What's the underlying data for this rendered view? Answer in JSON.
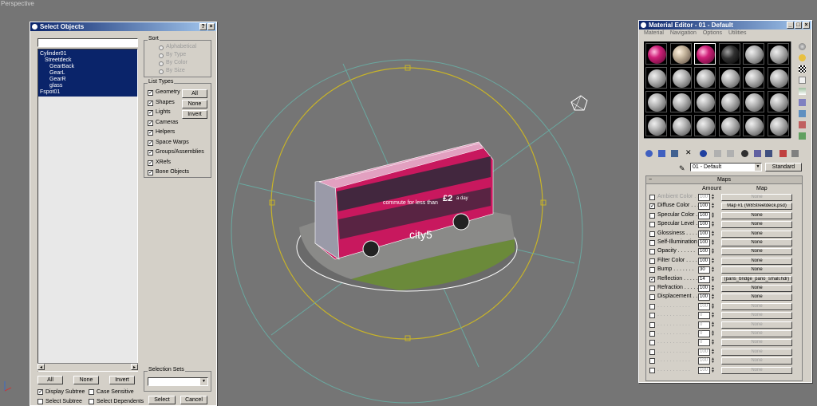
{
  "viewport": {
    "label": "Perspective"
  },
  "select_objects": {
    "title": "Select Objects",
    "help_btn": "?",
    "close_btn": "×",
    "search_value": "",
    "items": [
      {
        "label": "Cylinder01",
        "indent": 0
      },
      {
        "label": "Streetdeck",
        "indent": 1
      },
      {
        "label": "GearBack",
        "indent": 2
      },
      {
        "label": "GearL",
        "indent": 2
      },
      {
        "label": "GearR",
        "indent": 2
      },
      {
        "label": "glass",
        "indent": 2
      },
      {
        "label": "Fspot01",
        "indent": 0
      }
    ],
    "sort": {
      "title": "Sort",
      "options": [
        "Alphabetical",
        "By Type",
        "By Color",
        "By Size"
      ]
    },
    "list_types": {
      "title": "List Types",
      "items": [
        "Geometry",
        "Shapes",
        "Lights",
        "Cameras",
        "Helpers",
        "Space Warps",
        "Groups/Assemblies",
        "XRefs",
        "Bone Objects"
      ],
      "all_label": "All",
      "none_label": "None",
      "invert_label": "Invert"
    },
    "bottom": {
      "all": "All",
      "none": "None",
      "invert": "Invert",
      "display_subtree": "Display Subtree",
      "case_sensitive": "Case Sensitive",
      "select_subtree": "Select Subtree",
      "select_dependents": "Select Dependents"
    },
    "selection_sets": {
      "title": "Selection Sets",
      "value": ""
    },
    "select_btn": "Select",
    "cancel_btn": "Cancel"
  },
  "material_editor": {
    "title": "Material Editor - 01 - Default",
    "menu": [
      "Material",
      "Navigation",
      "Options",
      "Utilities"
    ],
    "material_name": "01 - Default",
    "type_btn": "Standard",
    "maps_title": "Maps",
    "col_amount": "Amount",
    "col_map": "Map",
    "maps": [
      {
        "name": "Ambient Color . . .",
        "checked": false,
        "amount": "100",
        "map": "None",
        "disabled": true
      },
      {
        "name": "Diffuse Color . . . .",
        "checked": true,
        "amount": "100",
        "map": "Map #1 (W8Streetdeck.psd)",
        "disabled": false
      },
      {
        "name": "Specular Color . . .",
        "checked": false,
        "amount": "100",
        "map": "None",
        "disabled": false
      },
      {
        "name": "Specular Level . . .",
        "checked": false,
        "amount": "100",
        "map": "None",
        "disabled": false
      },
      {
        "name": "Glossiness . . . . .",
        "checked": false,
        "amount": "100",
        "map": "None",
        "disabled": false
      },
      {
        "name": "Self-Illumination . .",
        "checked": false,
        "amount": "100",
        "map": "None",
        "disabled": false
      },
      {
        "name": "Opacity . . . . . .",
        "checked": false,
        "amount": "100",
        "map": "None",
        "disabled": false
      },
      {
        "name": "Filter Color . . . .",
        "checked": false,
        "amount": "100",
        "map": "None",
        "disabled": false
      },
      {
        "name": "Bump . . . . . . .",
        "checked": false,
        "amount": "30",
        "map": "None",
        "disabled": false
      },
      {
        "name": "Reflection . . . . .",
        "checked": true,
        "amount": "14",
        "map": "(paris_bridge_pano_small.hdr)",
        "disabled": false
      },
      {
        "name": "Refraction . . . . .",
        "checked": false,
        "amount": "100",
        "map": "None",
        "disabled": false
      },
      {
        "name": "Displacement . . . .",
        "checked": false,
        "amount": "100",
        "map": "None",
        "disabled": false
      },
      {
        "name": ". . . . . . . . . . .",
        "checked": false,
        "amount": "100",
        "map": "None",
        "disabled": true
      },
      {
        "name": ". . . . . . . . . . .",
        "checked": false,
        "amount": "0",
        "map": "None",
        "disabled": true
      },
      {
        "name": ". . . . . . . . . . .",
        "checked": false,
        "amount": "0",
        "map": "None",
        "disabled": true
      },
      {
        "name": ". . . . . . . . . . .",
        "checked": false,
        "amount": "0",
        "map": "None",
        "disabled": true
      },
      {
        "name": ". . . . . . . . . . .",
        "checked": false,
        "amount": "0",
        "map": "None",
        "disabled": true
      },
      {
        "name": ". . . . . . . . . . .",
        "checked": false,
        "amount": "100",
        "map": "None",
        "disabled": true
      },
      {
        "name": ". . . . . . . . . . .",
        "checked": false,
        "amount": "100",
        "map": "None",
        "disabled": true
      },
      {
        "name": ". . . . . . . . . . .",
        "checked": false,
        "amount": "100",
        "map": "None",
        "disabled": true
      }
    ]
  },
  "bus": {
    "ad_line1": "commute for less than",
    "ad_price": "£2",
    "ad_line2": "a day",
    "brand": "city5"
  },
  "colors": {
    "viewport_bg": "#757575",
    "bus_pink": "#c8185e",
    "selection_blue": "#0a246a",
    "gizmo_yellow": "#c8b428",
    "orbit_teal": "#6aa8a0"
  }
}
